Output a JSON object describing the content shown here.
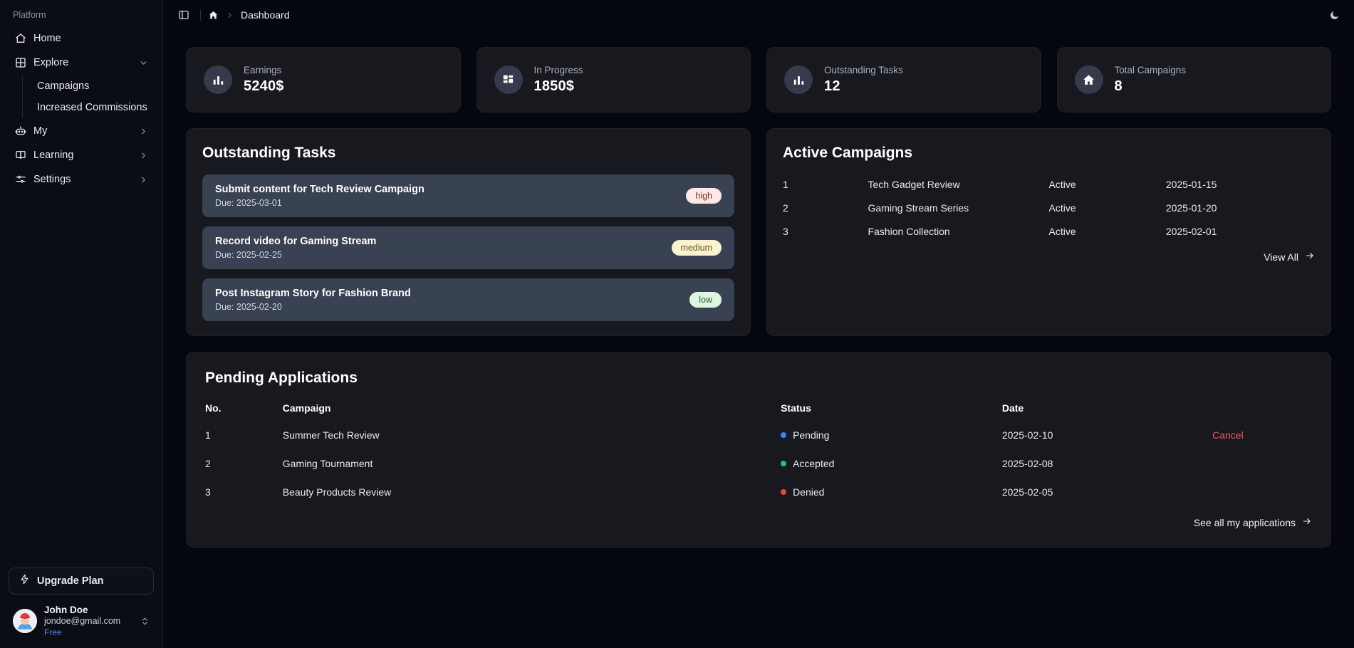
{
  "sidebar": {
    "section_label": "Platform",
    "items": [
      {
        "label": "Home",
        "icon": "home-icon",
        "chevron": ""
      },
      {
        "label": "Explore",
        "icon": "grid-icon",
        "chevron": "down"
      },
      {
        "label": "My",
        "icon": "robot-icon",
        "chevron": "right"
      },
      {
        "label": "Learning",
        "icon": "book-icon",
        "chevron": "right"
      },
      {
        "label": "Settings",
        "icon": "sliders-icon",
        "chevron": "right"
      }
    ],
    "explore_children": [
      {
        "label": "Campaigns"
      },
      {
        "label": "Increased Commissions"
      }
    ],
    "upgrade_label": "Upgrade Plan",
    "user": {
      "name": "John Doe",
      "email": "jondoe@gmail.com",
      "plan": "Free"
    }
  },
  "topbar": {
    "sidebar_toggle": "sidebar-toggle-icon",
    "home_crumb": "home-icon",
    "breadcrumb_current": "Dashboard",
    "theme_icon": "moon-icon"
  },
  "stats": [
    {
      "label": "Earnings",
      "value": "5240$",
      "icon": "bar-chart-icon"
    },
    {
      "label": "In Progress",
      "value": "1850$",
      "icon": "layout-dashboard-icon"
    },
    {
      "label": "Outstanding Tasks",
      "value": "12",
      "icon": "bar-chart-icon"
    },
    {
      "label": "Total Campaigns",
      "value": "8",
      "icon": "home-icon"
    }
  ],
  "tasks_panel": {
    "title": "Outstanding Tasks",
    "items": [
      {
        "title": "Submit content for Tech Review Campaign",
        "due": "Due: 2025-03-01",
        "priority": "high"
      },
      {
        "title": "Record video for Gaming Stream",
        "due": "Due: 2025-02-25",
        "priority": "medium"
      },
      {
        "title": "Post Instagram Story for Fashion Brand",
        "due": "Due: 2025-02-20",
        "priority": "low"
      }
    ]
  },
  "campaigns_panel": {
    "title": "Active Campaigns",
    "rows": [
      {
        "no": "1",
        "name": "Tech Gadget Review",
        "status": "Active",
        "date": "2025-01-15"
      },
      {
        "no": "2",
        "name": "Gaming Stream Series",
        "status": "Active",
        "date": "2025-01-20"
      },
      {
        "no": "3",
        "name": "Fashion Collection",
        "status": "Active",
        "date": "2025-02-01"
      }
    ],
    "view_all": "View All"
  },
  "applications_panel": {
    "title": "Pending Applications",
    "headers": {
      "no": "No.",
      "campaign": "Campaign",
      "status": "Status",
      "date": "Date",
      "action": ""
    },
    "rows": [
      {
        "no": "1",
        "campaign": "Summer Tech Review",
        "status": "Pending",
        "status_color": "#3b82f6",
        "date": "2025-02-10",
        "action": "Cancel"
      },
      {
        "no": "2",
        "campaign": "Gaming Tournament",
        "status": "Accepted",
        "status_color": "#22c55e",
        "date": "2025-02-08",
        "action": ""
      },
      {
        "no": "3",
        "campaign": "Beauty Products Review",
        "status": "Denied",
        "status_color": "#ef4444",
        "date": "2025-02-05",
        "action": ""
      }
    ],
    "see_all": "See all my applications"
  },
  "colors": {
    "page_bg": "#05070f",
    "card_bg": "#17191e",
    "task_bg": "#394252",
    "accent_link": "#4b8ff5",
    "cancel": "#f0555f"
  }
}
